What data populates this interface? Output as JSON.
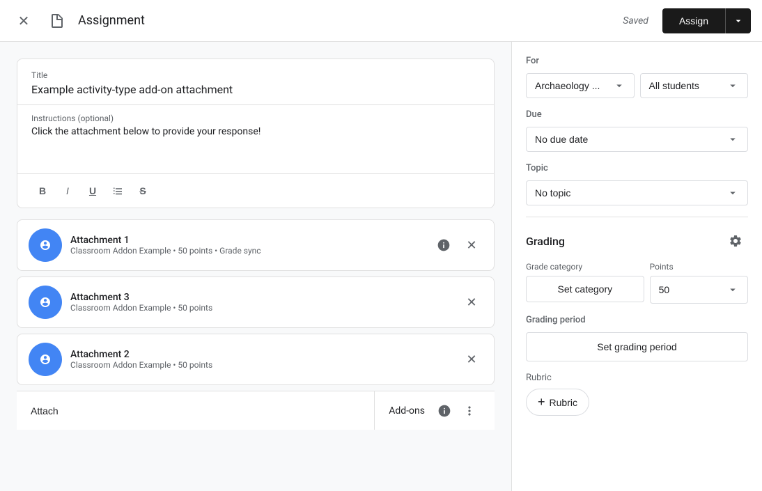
{
  "topbar": {
    "title": "Assignment",
    "saved_label": "Saved",
    "assign_label": "Assign"
  },
  "assignment": {
    "title_label": "Title",
    "title_value": "Example activity-type add-on attachment",
    "instructions_label": "Instructions (optional)",
    "instructions_value": "Click the attachment below to provide your response!"
  },
  "attachments": [
    {
      "name": "Attachment 1",
      "meta": "Classroom Addon Example • 50 points • Grade sync"
    },
    {
      "name": "Attachment 3",
      "meta": "Classroom Addon Example • 50 points"
    },
    {
      "name": "Attachment 2",
      "meta": "Classroom Addon Example • 50 points"
    }
  ],
  "bottom_toolbar": {
    "attach_label": "Attach",
    "addons_label": "Add-ons"
  },
  "right_panel": {
    "for_label": "For",
    "class_dropdown": "Archaeology ...",
    "students_dropdown": "All students",
    "due_label": "Due",
    "due_dropdown": "No due date",
    "topic_label": "Topic",
    "topic_dropdown": "No topic",
    "grading_label": "Grading",
    "grade_category_label": "Grade category",
    "set_category_label": "Set category",
    "points_label": "Points",
    "points_value": "50",
    "grading_period_label": "Grading period",
    "set_grading_period_label": "Set grading period",
    "rubric_label": "Rubric",
    "add_rubric_label": "Rubric"
  }
}
